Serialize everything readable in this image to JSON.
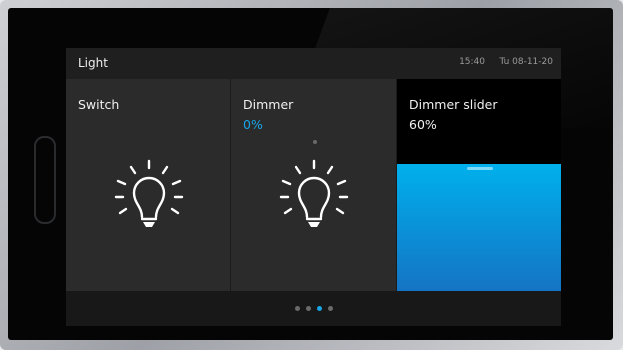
{
  "header": {
    "title": "Light",
    "time": "15:40",
    "date": "Tu 08-11-20"
  },
  "tiles": [
    {
      "label": "Switch",
      "value": ""
    },
    {
      "label": "Dimmer",
      "value": "0%"
    },
    {
      "label": "Dimmer slider",
      "value": "60%",
      "level": 0.6
    }
  ],
  "pager": {
    "pages": 4,
    "active": 2
  },
  "colors": {
    "accent": "#18a6e8",
    "slider_top": "#00b0ec",
    "slider_bottom": "#1474c4",
    "tile_bg": "#2b2b2b"
  },
  "icons": [
    "bulb-icon",
    "bulb-icon"
  ]
}
